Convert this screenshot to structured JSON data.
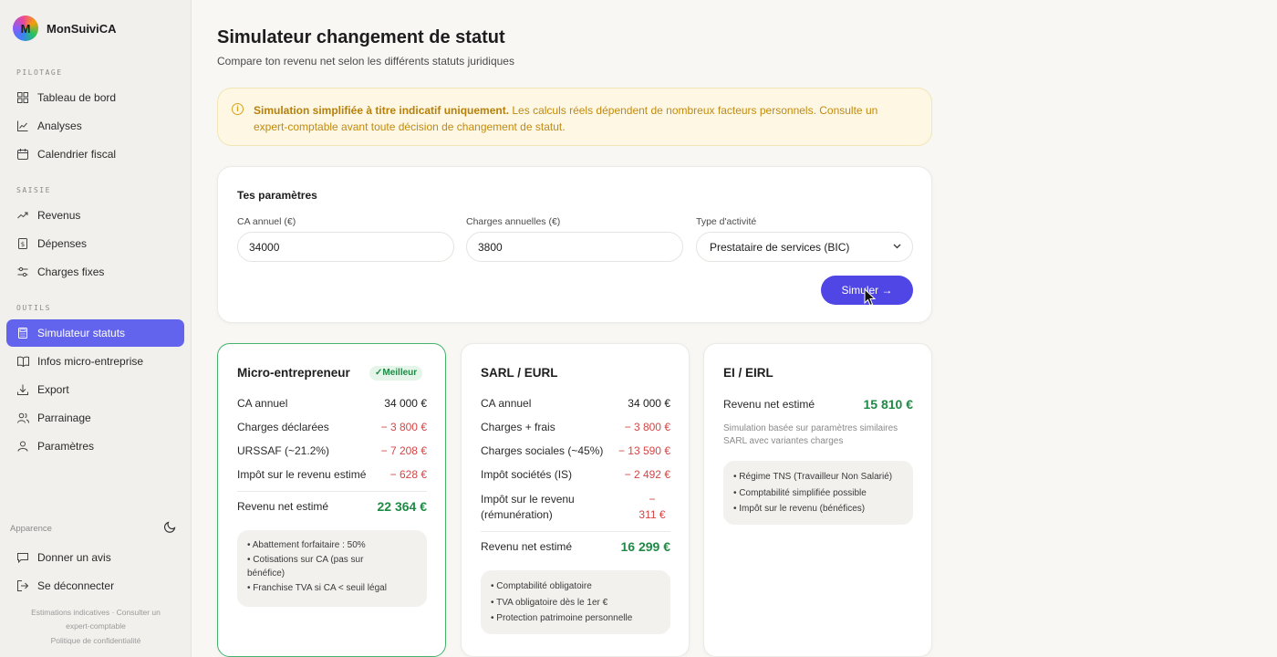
{
  "app": {
    "name": "MonSuiviCA",
    "logo_glyph": "M"
  },
  "sidebar": {
    "sections": {
      "pilotage": "PILOTAGE",
      "saisie": "SAISIE",
      "outils": "OUTILS"
    },
    "items": [
      {
        "label": "Tableau de bord",
        "icon": "grid-icon"
      },
      {
        "label": "Analyses",
        "icon": "chart-icon"
      },
      {
        "label": "Calendrier fiscal",
        "icon": "calendar-icon"
      },
      {
        "label": "Revenus",
        "icon": "trend-up-icon"
      },
      {
        "label": "Dépenses",
        "icon": "receipt-icon"
      },
      {
        "label": "Charges fixes",
        "icon": "sliders-icon"
      },
      {
        "label": "Simulateur statuts",
        "icon": "calculator-icon",
        "active": true
      },
      {
        "label": "Infos micro-entreprise",
        "icon": "book-icon"
      },
      {
        "label": "Export",
        "icon": "download-icon"
      },
      {
        "label": "Parrainage",
        "icon": "users-icon"
      },
      {
        "label": "Paramètres",
        "icon": "user-icon"
      }
    ],
    "appearance_label": "Apparence",
    "feedback": "Donner un avis",
    "logout": "Se déconnecter",
    "disclaimer": "Estimations indicatives · Consulter un expert-comptable",
    "privacy": "Politique de confidentialité"
  },
  "main": {
    "title": "Simulateur changement de statut",
    "subtitle": "Compare ton revenu net selon les différents statuts juridiques",
    "alert_bold": "Simulation simplifiée à titre indicatif uniquement.",
    "alert_text": " Les calculs réels dépendent de nombreux facteurs personnels. Consulte un expert-comptable avant toute décision de changement de statut."
  },
  "params": {
    "title": "Tes paramètres",
    "ca_label": "CA annuel (€)",
    "ca_value": "34000",
    "charges_label": "Charges annuelles (€)",
    "charges_value": "3800",
    "activity_label": "Type d'activité",
    "activity_value": "Prestataire de services (BIC)",
    "simulate_button": "Simuler →"
  },
  "cards": {
    "micro": {
      "title": "Micro-entrepreneur",
      "badge": "✓Meilleur",
      "rows": [
        {
          "label": "CA annuel",
          "value": "34 000 €"
        },
        {
          "label": "Charges déclarées",
          "value": "− 3 800 €"
        },
        {
          "label": "URSSAF (~21.2%)",
          "value": "− 7 208 €"
        },
        {
          "label": "Impôt sur le revenu estimé",
          "value": "− 628 €"
        }
      ],
      "net_label": "Revenu net estimé",
      "net_value": "22 364 €",
      "notes": [
        "• Abattement forfaitaire : 50%",
        "• Cotisations sur CA (pas sur bénéfice)",
        "• Franchise TVA si CA < seuil légal"
      ]
    },
    "sarl": {
      "title": "SARL / EURL",
      "rows": [
        {
          "label": "CA annuel",
          "value": "34 000 €"
        },
        {
          "label": "Charges + frais",
          "value": "− 3 800 €"
        },
        {
          "label": "Charges sociales (~45%)",
          "value": "− 13 590 €"
        },
        {
          "label": "Impôt sociétés (IS)",
          "value": "− 2 492 €"
        }
      ],
      "ir_label_1": "Impôt sur le revenu",
      "ir_label_2": "(rémunération)",
      "ir_value_1": "−",
      "ir_value_2": "311 €",
      "net_label": "Revenu net estimé",
      "net_value": "16 299 €",
      "notes": [
        "• Comptabilité obligatoire",
        "• TVA obligatoire dès le 1er €",
        "• Protection patrimoine personnelle"
      ]
    },
    "ei": {
      "title": "EI / EIRL",
      "net_label": "Revenu net estimé",
      "net_value": "15 810 €",
      "note": "Simulation basée sur paramètres similaires SARL avec variantes charges",
      "notes": [
        "• Régime TNS (Travailleur Non Salarié)",
        "• Comptabilité simplifiée possible",
        "• Impôt sur le revenu (bénéfices)"
      ]
    }
  },
  "colors": {
    "accent": "#6364ee",
    "button": "#4f46e5",
    "positive": "#1f8a45",
    "negative": "#d64545",
    "warning": "#c28a10"
  }
}
